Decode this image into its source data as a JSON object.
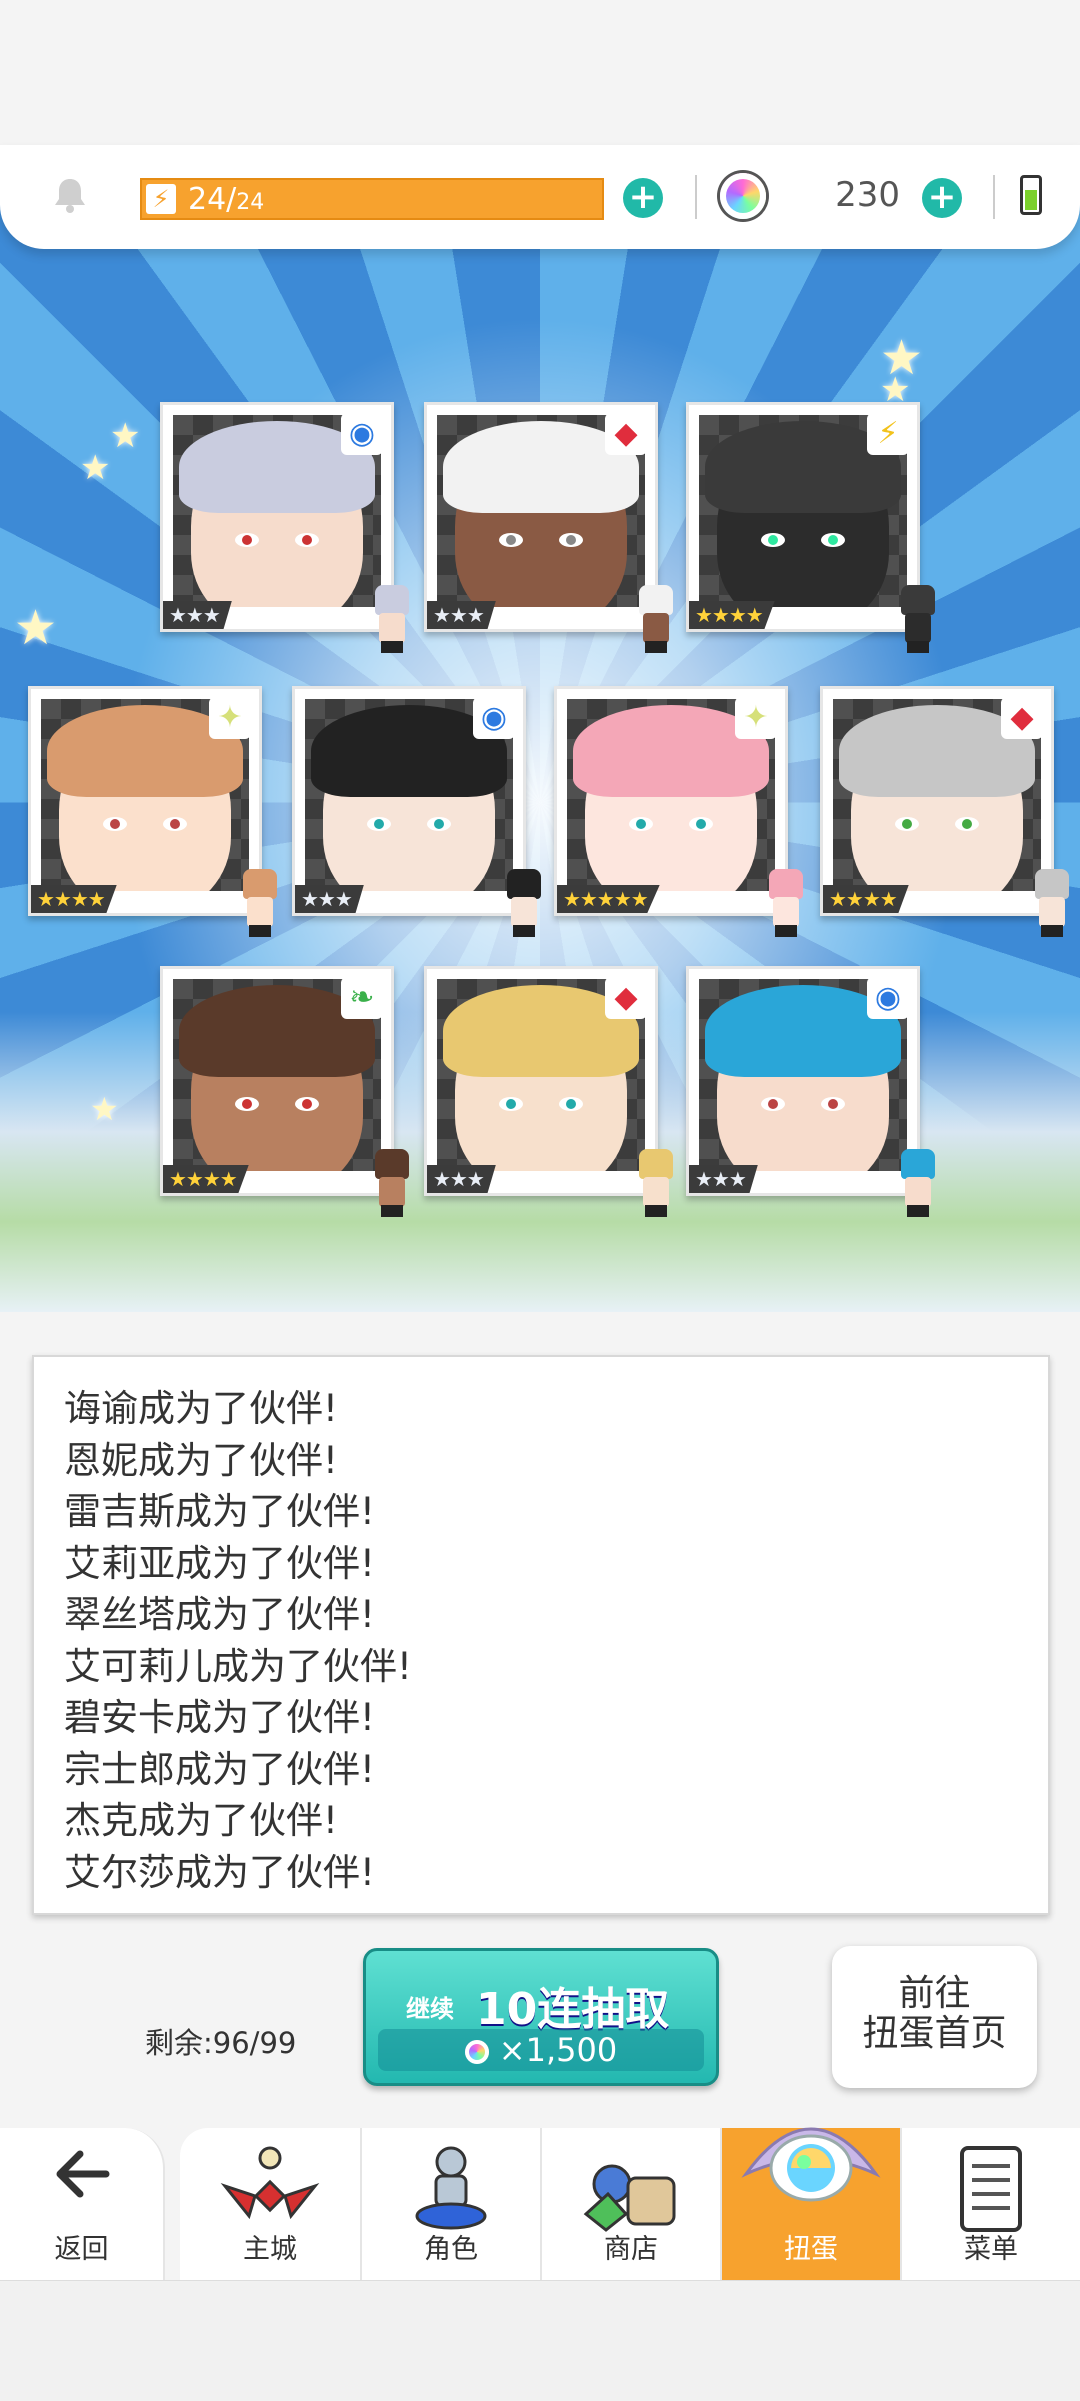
{
  "status_bar": {
    "energy": "24/",
    "energy_max": "24",
    "gem_count": "230"
  },
  "cards": [
    {
      "rarity": "★★★",
      "attribute": "circle",
      "colors": {
        "hair": "#c9ccdf",
        "skin": "#f6dccc",
        "eye": "#c33"
      }
    },
    {
      "rarity": "★★★",
      "attribute": "diamond",
      "colors": {
        "hair": "#f2f2f2",
        "skin": "#8a5a44",
        "eye": "#888"
      }
    },
    {
      "rarity": "★★★★",
      "attribute": "lightning",
      "colors": {
        "hair": "#3a3a3a",
        "skin": "#2c2c2c",
        "eye": "#2ee8a0"
      }
    },
    {
      "rarity": "★★★★",
      "attribute": "light",
      "colors": {
        "hair": "#d99b6e",
        "skin": "#fbe0cc",
        "eye": "#b44"
      }
    },
    {
      "rarity": "★★★",
      "attribute": "circle",
      "colors": {
        "hair": "#222",
        "skin": "#f7e4d8",
        "eye": "#2aa"
      }
    },
    {
      "rarity": "★★★★★",
      "attribute": "light",
      "colors": {
        "hair": "#f4a7b7",
        "skin": "#fde6de",
        "eye": "#2aa"
      }
    },
    {
      "rarity": "★★★★",
      "attribute": "diamond",
      "colors": {
        "hair": "#c6c6c6",
        "skin": "#f7e4d8",
        "eye": "#4a4"
      }
    },
    {
      "rarity": "★★★★",
      "attribute": "leaf",
      "colors": {
        "hair": "#5a3a2a",
        "skin": "#b88060",
        "eye": "#c33"
      }
    },
    {
      "rarity": "★★★",
      "attribute": "diamond",
      "colors": {
        "hair": "#e8c870",
        "skin": "#f7e0cc",
        "eye": "#2aa"
      }
    },
    {
      "rarity": "★★★",
      "attribute": "circle",
      "colors": {
        "hair": "#2aa6d8",
        "skin": "#f7dccc",
        "eye": "#b44"
      }
    }
  ],
  "log_lines": [
    "诲谕成为了伙伴!",
    "恩妮成为了伙伴!",
    "雷吉斯成为了伙伴!",
    "艾莉亚成为了伙伴!",
    "翠丝塔成为了伙伴!",
    "艾可莉儿成为了伙伴!",
    "碧安卡成为了伙伴!",
    "宗士郎成为了伙伴!",
    "杰克成为了伙伴!",
    "艾尔莎成为了伙伴!"
  ],
  "gacha": {
    "remaining": "剩余:96/99",
    "continue_label": "继续",
    "pull_label": "10连抽取",
    "cost": "×1,500",
    "home_line1": "前往",
    "home_line2": "扭蛋首页"
  },
  "nav": {
    "back": "返回",
    "city": "主城",
    "characters": "角色",
    "shop": "商店",
    "gacha": "扭蛋",
    "menu": "菜单"
  },
  "theme": {
    "accent": "#f7a22e",
    "teal": "#21b9a8"
  }
}
